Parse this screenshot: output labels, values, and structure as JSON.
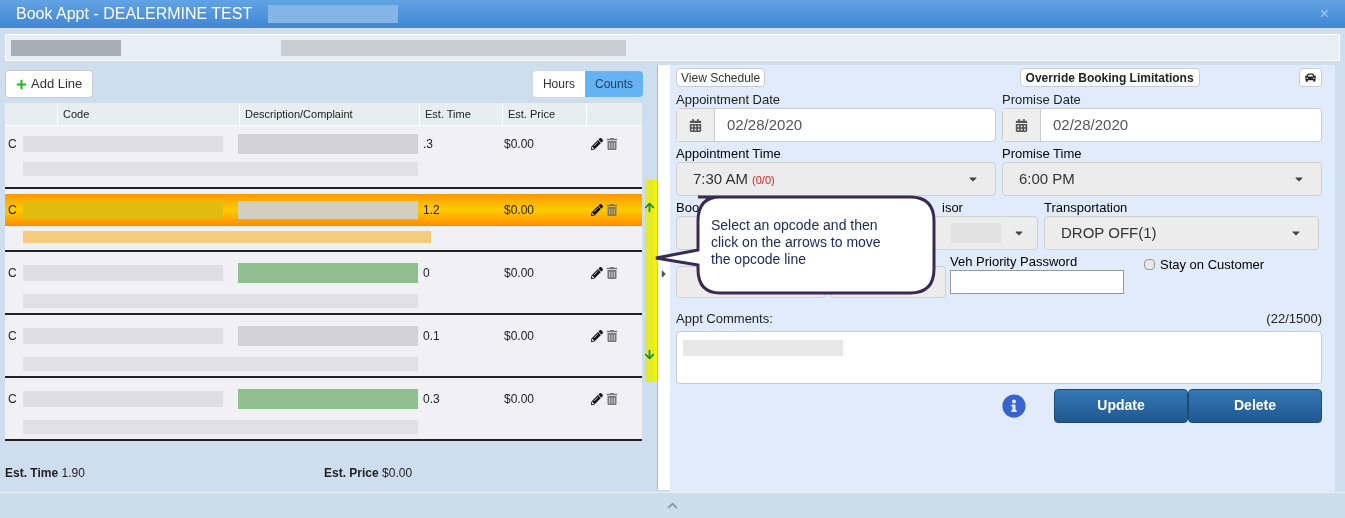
{
  "window": {
    "title": "Book Appt - DEALERMINE TEST",
    "close": "×"
  },
  "left": {
    "add_button": "Add Line",
    "toggle": [
      {
        "label": "Hours",
        "selected": false
      },
      {
        "label": "Counts",
        "selected": true
      }
    ],
    "table": {
      "columns": [
        "Code",
        "Description/Complaint",
        "Est. Time",
        "Est. Price"
      ],
      "rows": [
        {
          "type": "C",
          "est_time": ".3",
          "est_price": "$0.00",
          "selected": false,
          "color": "#d2d2d8"
        },
        {
          "type": "C",
          "est_time": "1.2",
          "est_price": "$0.00",
          "selected": true,
          "color": "#d2cfc0"
        },
        {
          "type": "C",
          "est_time": "0",
          "est_price": "$0.00",
          "selected": false,
          "color": "#8fbf8f"
        },
        {
          "type": "C",
          "est_time": "0.1",
          "est_price": "$0.00",
          "selected": false,
          "color": "#d2d2d8"
        },
        {
          "type": "C",
          "est_time": "0.3",
          "est_price": "$0.00",
          "selected": false,
          "color": "#8fbf8f"
        }
      ]
    },
    "totals": [
      {
        "label": "Est. Time",
        "value": "1.90"
      },
      {
        "label": "Est. Price",
        "value": "$0.00"
      }
    ]
  },
  "right": {
    "view_schedule": "View Schedule",
    "override": "Override Booking Limitations",
    "appointment_date": {
      "label": "Appointment Date",
      "value": "02/28/2020"
    },
    "promise_date": {
      "label": "Promise Date",
      "value": "02/28/2020"
    },
    "appointment_time": {
      "label": "Appointment Time",
      "value": "7:30 AM",
      "count": "(0/0)"
    },
    "promise_time": {
      "label": "Promise Time",
      "value": "6:00 PM"
    },
    "booking_label": "Boo",
    "advisor_label": "isor",
    "transportation": {
      "label": "Transportation",
      "value": "DROP OFF(1)"
    },
    "veh_priority_password": {
      "label": "Veh Priority Password"
    },
    "stay_on_customer": {
      "label": "Stay on Customer",
      "checked": false
    },
    "comments": {
      "label": "Appt Comments:",
      "counter": "(22/1500)"
    },
    "buttons": [
      "Update",
      "Delete"
    ]
  },
  "callout": {
    "text": "Select an opcode and then click on the arrows to move the opcode line"
  }
}
